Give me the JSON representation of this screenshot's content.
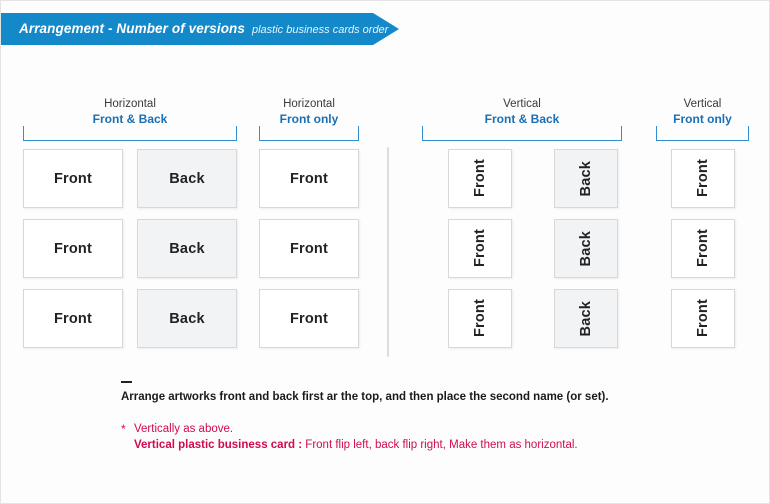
{
  "banner": {
    "title": "Arrangement - Number of versions",
    "subtitle": "plastic business cards order"
  },
  "groups": [
    {
      "orientation": "Horizontal",
      "sides": "Front & Back",
      "columns": [
        "Front",
        "Back"
      ],
      "rows": 3,
      "card_type": "horizontal"
    },
    {
      "orientation": "Horizontal",
      "sides": "Front only",
      "columns": [
        "Front"
      ],
      "rows": 3,
      "card_type": "horizontal"
    },
    {
      "orientation": "Vertical",
      "sides": "Front & Back",
      "columns": [
        "Front",
        "Back"
      ],
      "rows": 3,
      "card_type": "vertical"
    },
    {
      "orientation": "Vertical",
      "sides": "Front only",
      "columns": [
        "Front"
      ],
      "rows": 3,
      "card_type": "vertical"
    }
  ],
  "notes": {
    "main": "Arrange artworks front and back first ar the top, and then place the second name (or set).",
    "asterisk": "*",
    "line1": "Vertically as above.",
    "line2_strong": "Vertical plastic business card :",
    "line2_rest": " Front flip left, back flip right, Make them as horizontal."
  },
  "colors": {
    "banner": "#1389c9",
    "accent_blue": "#1a6fb5",
    "note_red": "#d10b4e",
    "back_card": "#f2f3f4"
  }
}
